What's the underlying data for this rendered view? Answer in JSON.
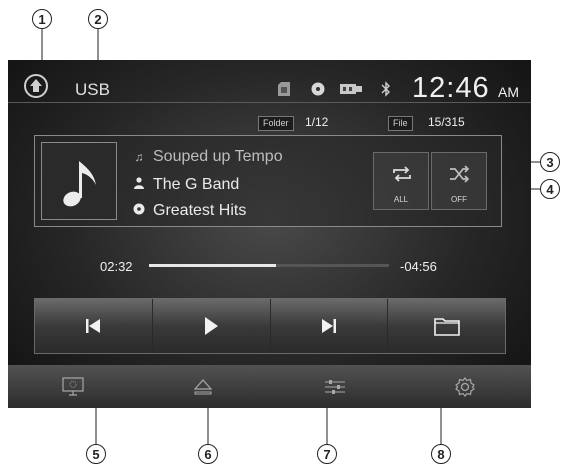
{
  "callouts": [
    "1",
    "2",
    "3",
    "4",
    "5",
    "6",
    "7",
    "8"
  ],
  "status": {
    "source": "USB",
    "time": "12:46",
    "ampm": "AM",
    "folder_label": "Folder",
    "folder_value": "1/12",
    "file_label": "File",
    "file_value": "15/315"
  },
  "track": {
    "title": "Souped up Tempo",
    "artist": "The G Band",
    "album": "Greatest Hits"
  },
  "modes": {
    "repeat_label": "ALL",
    "shuffle_label": "OFF"
  },
  "progress": {
    "elapsed": "02:32",
    "remaining": "-04:56",
    "fraction": 0.53
  },
  "icons": {
    "home": "home-icon",
    "sd": "sd-card-icon",
    "disc": "disc-icon",
    "usb": "usb-icon",
    "bluetooth": "bluetooth-icon",
    "note": "music-note-icon",
    "person": "person-icon",
    "album": "album-icon",
    "repeat": "repeat-icon",
    "shuffle": "shuffle-icon",
    "prev": "previous-track-icon",
    "play": "play-icon",
    "next": "next-track-icon",
    "folder": "folder-icon",
    "display": "display-icon",
    "eject": "eject-icon",
    "eq": "equalizer-icon",
    "settings": "settings-gear-icon"
  }
}
